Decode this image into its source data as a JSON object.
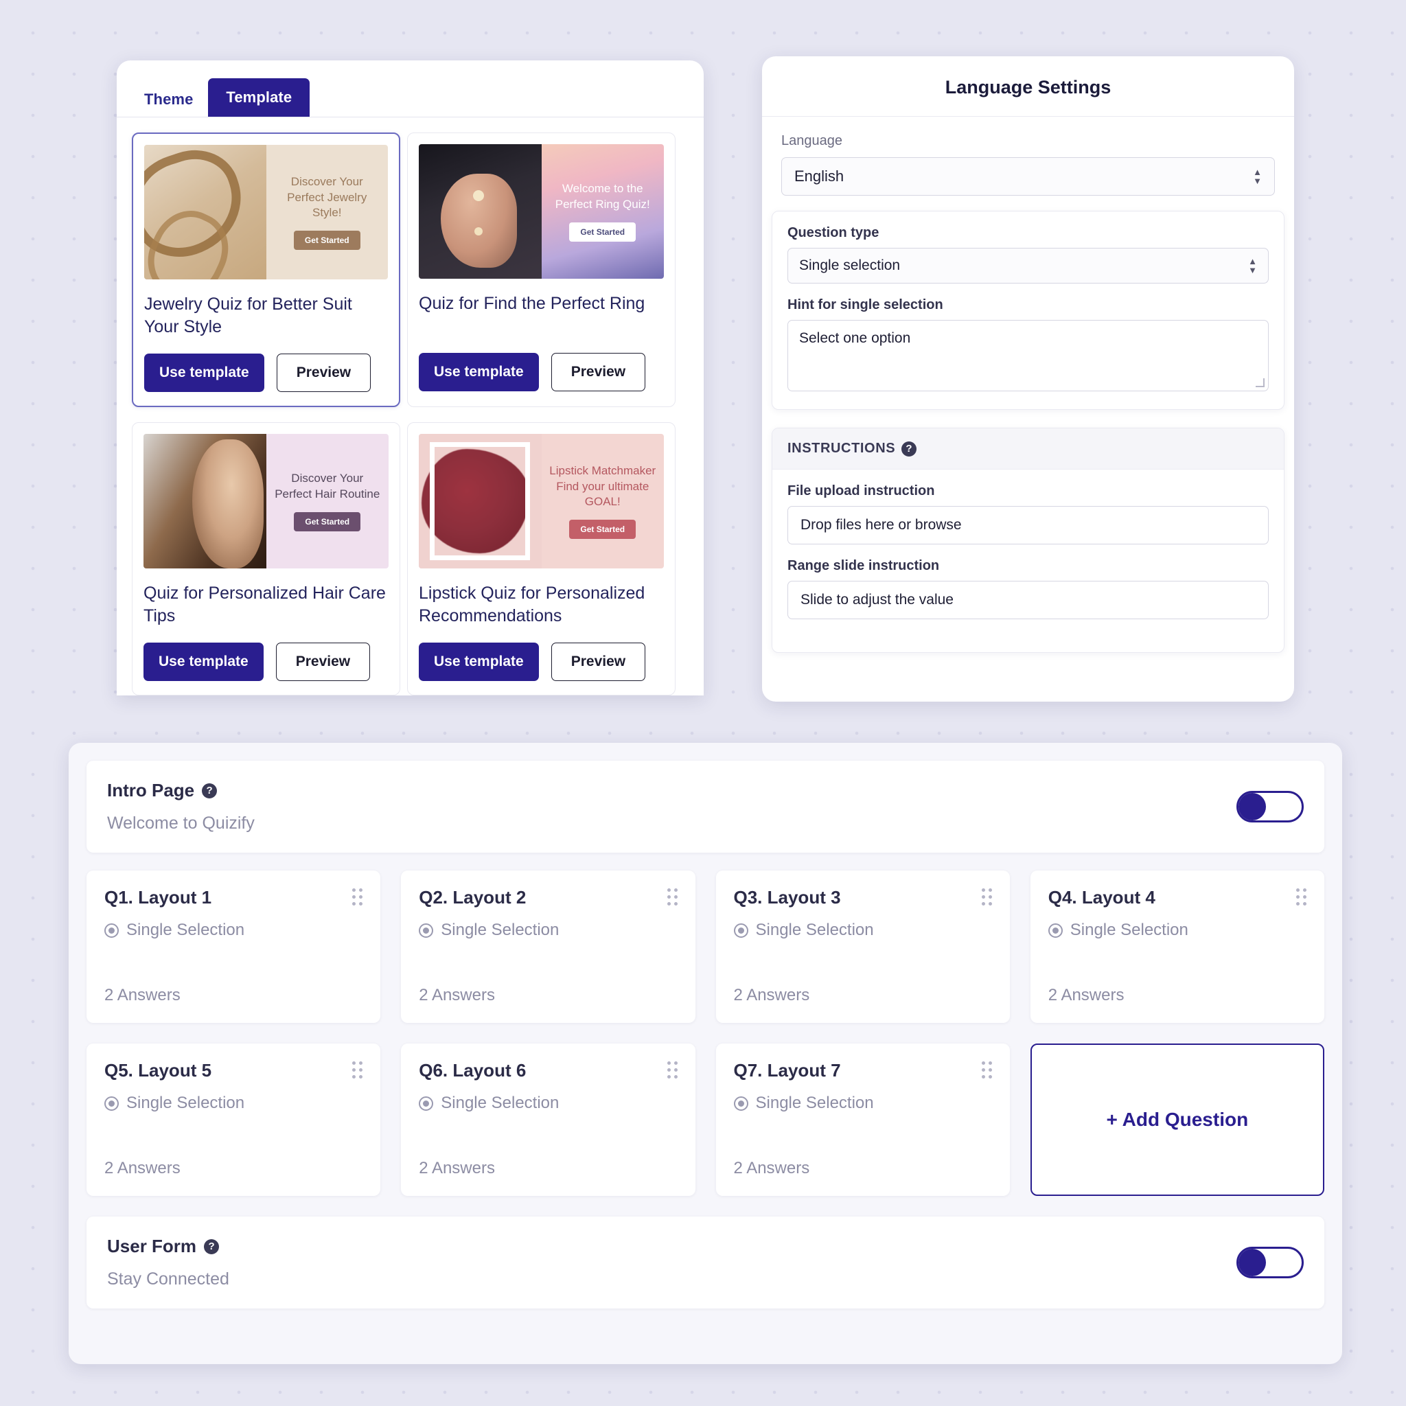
{
  "template_panel": {
    "tabs": [
      {
        "label": "Theme",
        "active": false
      },
      {
        "label": "Template",
        "active": true
      }
    ],
    "buttons": {
      "use": "Use template",
      "preview": "Preview"
    },
    "templates": [
      {
        "name": "Jewelry Quiz for Better Suit Your Style",
        "thumb_title": "Discover Your Perfect Jewelry Style!",
        "thumb_cta": "Get Started",
        "art": "art-jewel",
        "bg": "#ece0d1",
        "title_color": "#9a7a5c",
        "cta_bg": "#9d7b5d",
        "cta_color": "#ffffff",
        "selected": true
      },
      {
        "name": "Quiz for Find the Perfect Ring",
        "thumb_title": "Welcome to the Perfect Ring Quiz!",
        "thumb_cta": "Get Started",
        "art": "art-ring",
        "bg": "linear-gradient(165deg,#f7d9b4 0%,#f0b7c4 40%,#b9a8dc 75%,#6f6bb0 100%)",
        "title_color": "#ffffff",
        "cta_bg": "#ffffff",
        "cta_color": "#4b4b7a",
        "selected": false
      },
      {
        "name": "Quiz for Personalized Hair Care Tips",
        "thumb_title": "Discover Your Perfect Hair Routine",
        "thumb_cta": "Get Started",
        "art": "art-hair",
        "bg": "#f0e0ee",
        "title_color": "#55485c",
        "cta_bg": "#6b4f6e",
        "cta_color": "#ffffff",
        "selected": false
      },
      {
        "name": "Lipstick Quiz for Personalized Recommendations",
        "thumb_title": "Lipstick Matchmaker Find your ultimate GOAL!",
        "thumb_cta": "Get Started",
        "art": "art-lips",
        "bg": "#f3d6d2",
        "title_color": "#b4575f",
        "cta_bg": "#c35f68",
        "cta_color": "#ffffff",
        "selected": false
      }
    ]
  },
  "language_panel": {
    "title": "Language Settings",
    "language_label": "Language",
    "language_value": "English",
    "question_type_label": "Question type",
    "question_type_value": "Single selection",
    "hint_label": "Hint for single selection",
    "hint_value": "Select one option",
    "instructions_heading": "INSTRUCTIONS",
    "help_glyph": "?",
    "file_upload_label": "File upload instruction",
    "file_upload_value": "Drop files here or browse",
    "range_slide_label": "Range slide instruction",
    "range_slide_value": "Slide to adjust the value"
  },
  "builder": {
    "intro": {
      "title": "Intro Page",
      "help_glyph": "?",
      "subtitle": "Welcome to Quizify",
      "toggle_on": false
    },
    "user_form": {
      "title": "User Form",
      "help_glyph": "?",
      "subtitle": "Stay Connected",
      "toggle_on": false
    },
    "add_question_label": "+ Add Question",
    "questions": [
      {
        "title": "Q1. Layout 1",
        "type": "Single Selection",
        "answers": "2 Answers"
      },
      {
        "title": "Q2. Layout 2",
        "type": "Single Selection",
        "answers": "2 Answers"
      },
      {
        "title": "Q3. Layout 3",
        "type": "Single Selection",
        "answers": "2 Answers"
      },
      {
        "title": "Q4. Layout 4",
        "type": "Single Selection",
        "answers": "2 Answers"
      },
      {
        "title": "Q5. Layout 5",
        "type": "Single Selection",
        "answers": "2 Answers"
      },
      {
        "title": "Q6. Layout 6",
        "type": "Single Selection",
        "answers": "2 Answers"
      },
      {
        "title": "Q7. Layout 7",
        "type": "Single Selection",
        "answers": "2 Answers"
      }
    ]
  },
  "colors": {
    "brand": "#2a1e8f",
    "page_bg": "#e6e6f2",
    "muted_text": "#8c8ca3",
    "heading_text": "#2b2b47"
  }
}
